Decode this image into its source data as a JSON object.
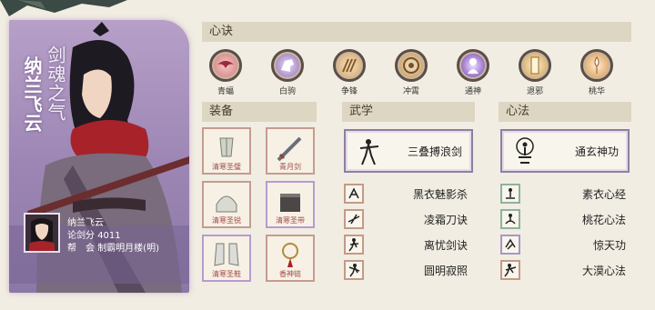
{
  "character": {
    "name": "纳兰飞云",
    "title": "剑魂之气",
    "sword_score_label": "论剑分",
    "sword_score": "4011",
    "guild_label": "帮　会",
    "guild_name": "制霸明月楼(明)"
  },
  "sections": {
    "xinjue": "心诀",
    "equipment": "装备",
    "martial": "武学",
    "mind": "心法"
  },
  "xinjue": [
    {
      "label": "青蝠",
      "icon": "bat-icon"
    },
    {
      "label": "白驹",
      "icon": "horse-icon"
    },
    {
      "label": "争锋",
      "icon": "claw-icon"
    },
    {
      "label": "冲霄",
      "icon": "vortex-icon"
    },
    {
      "label": "通神",
      "icon": "spirit-icon"
    },
    {
      "label": "退邪",
      "icon": "talisman-icon"
    },
    {
      "label": "桃华",
      "icon": "blossom-icon"
    }
  ],
  "equipment": [
    {
      "label": "清寒圣璧",
      "icon": "jade-icon"
    },
    {
      "label": "青月剑",
      "icon": "sword-icon"
    },
    {
      "label": "清寒圣锐",
      "icon": "helmet-icon"
    },
    {
      "label": "清寒圣带",
      "icon": "belt-icon"
    },
    {
      "label": "清寒圣鞋",
      "icon": "boots-icon"
    },
    {
      "label": "香神链",
      "icon": "necklace-icon"
    }
  ],
  "martial": {
    "main": "三叠搏浪剑",
    "list": [
      "黑衣魅影杀",
      "凌霜刀诀",
      "离忧剑诀",
      "圆明寂照"
    ]
  },
  "mind": {
    "main": "通玄神功",
    "list": [
      "素衣心经",
      "桃花心法",
      "惊天功",
      "大漠心法"
    ]
  },
  "colors": {
    "background": "#f1ede2",
    "card": "#9c85b3",
    "header": "#ddd6c3",
    "equip_border": "#c49c92"
  }
}
